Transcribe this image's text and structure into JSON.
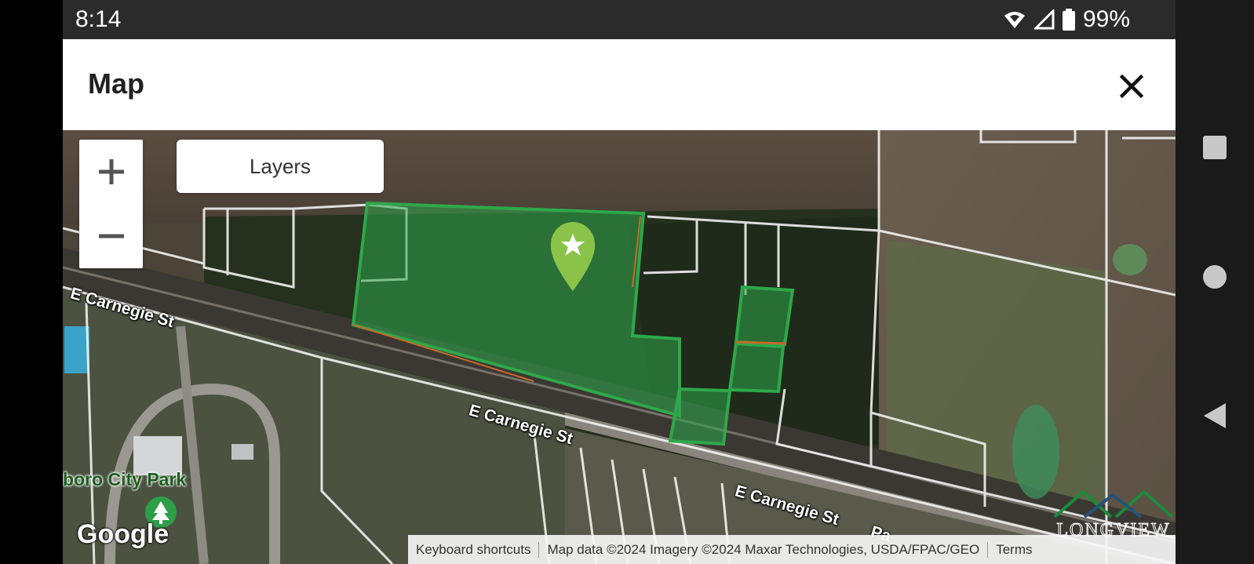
{
  "status_bar": {
    "time": "8:14",
    "battery": "99%"
  },
  "header": {
    "title": "Map"
  },
  "map": {
    "layers_label": "Layers",
    "streets": [
      "E Carnegie St",
      "E Carnegie St",
      "E Carnegie St",
      "Pa"
    ],
    "park_name": "boro City Park",
    "google_logo": "Google",
    "attribution": {
      "shortcuts": "Keyboard shortcuts",
      "data": "Map data ©2024 Imagery ©2024 Maxar Technologies, USDA/FPAC/GEO",
      "terms": "Terms"
    },
    "watermark": "LONGVIEW",
    "parcel_color": "#2ea84a",
    "marker_color": "#8bc34a"
  },
  "icons": {
    "close": "close-icon",
    "zoom_in": "plus-icon",
    "zoom_out": "minus-icon",
    "park": "tree-icon",
    "marker": "location-pin-icon"
  }
}
